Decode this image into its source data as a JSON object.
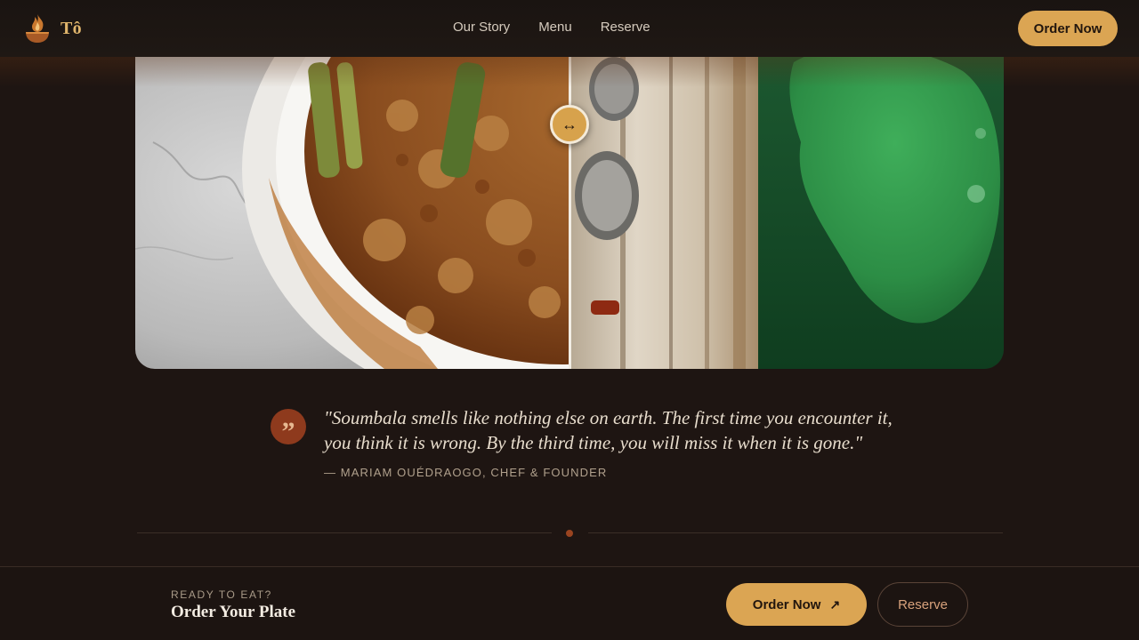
{
  "header": {
    "brand_name": "Tô",
    "nav": [
      "Our Story",
      "Menu",
      "Reserve"
    ],
    "order_button": "Order Now"
  },
  "comparison": {
    "handle_symbol": "↔",
    "split_position_percent": 50
  },
  "quote": {
    "mark": "”",
    "text": "\"Soumbala smells like nothing else on earth. The first time you encounter it, you think it is wrong. By the third time, you will miss it when it is gone.\"",
    "author": "— MARIAM OUÉDRAOGO, CHEF & FOUNDER"
  },
  "cta": {
    "eyebrow": "READY TO EAT?",
    "title": "Order Your Plate",
    "order_label": "Order Now",
    "order_arrow": "↗",
    "reserve_label": "Reserve"
  },
  "colors": {
    "background": "#1e1512",
    "accent_gold": "#dba553",
    "accent_rust": "#8e3a1d"
  }
}
